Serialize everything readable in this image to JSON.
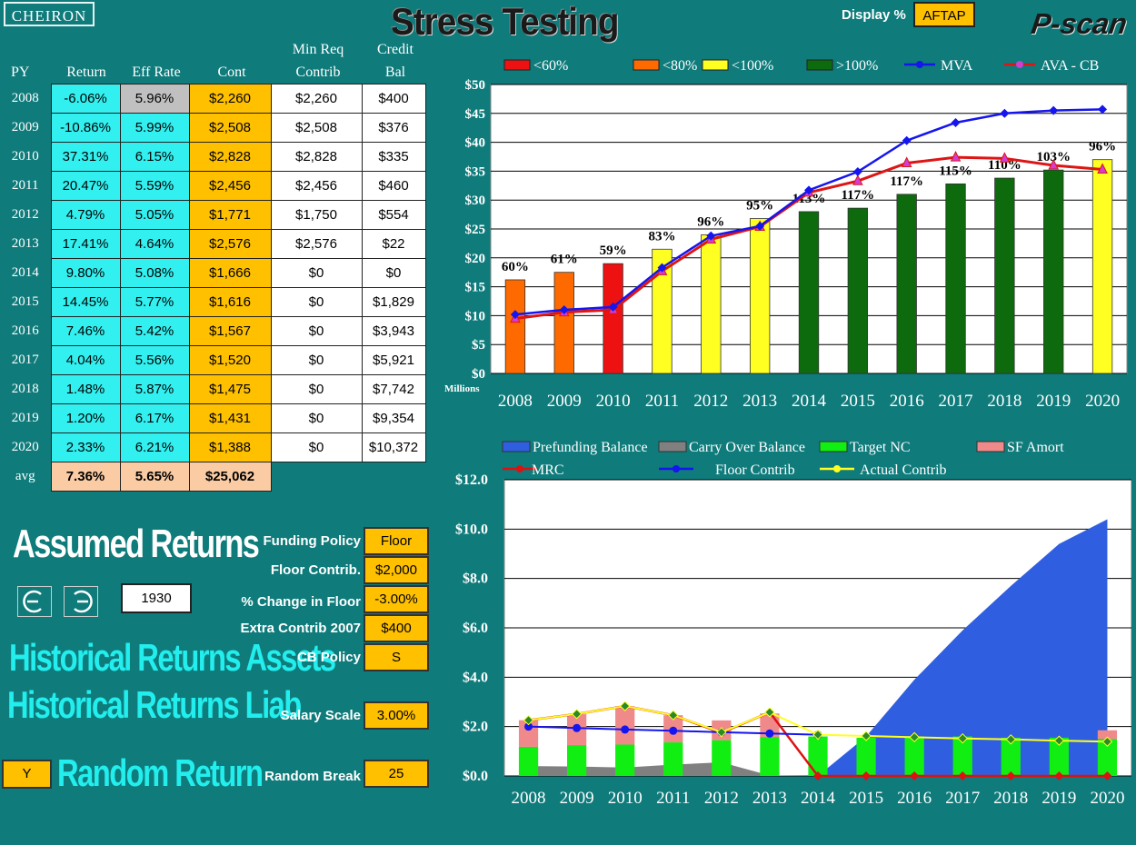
{
  "header": {
    "logo": "CHEIRON",
    "title": "Stress Testing",
    "display_label": "Display %",
    "display_value": "AFTAP",
    "brand": "P-scan"
  },
  "table": {
    "headers": {
      "py": "PY",
      "return": "Return",
      "eff": "Eff Rate",
      "cont": "Cont",
      "minreq1": "Min Req",
      "minreq2": "Contrib",
      "credit1": "Credit",
      "credit2": "Bal"
    },
    "rows": [
      {
        "py": "2008",
        "ret": "-6.06%",
        "eff": "5.96%",
        "cont": "$2,260",
        "min": "$2,260",
        "cred": "$400"
      },
      {
        "py": "2009",
        "ret": "-10.86%",
        "eff": "5.99%",
        "cont": "$2,508",
        "min": "$2,508",
        "cred": "$376"
      },
      {
        "py": "2010",
        "ret": "37.31%",
        "eff": "6.15%",
        "cont": "$2,828",
        "min": "$2,828",
        "cred": "$335"
      },
      {
        "py": "2011",
        "ret": "20.47%",
        "eff": "5.59%",
        "cont": "$2,456",
        "min": "$2,456",
        "cred": "$460"
      },
      {
        "py": "2012",
        "ret": "4.79%",
        "eff": "5.05%",
        "cont": "$1,771",
        "min": "$1,750",
        "cred": "$554"
      },
      {
        "py": "2013",
        "ret": "17.41%",
        "eff": "4.64%",
        "cont": "$2,576",
        "min": "$2,576",
        "cred": "$22"
      },
      {
        "py": "2014",
        "ret": "9.80%",
        "eff": "5.08%",
        "cont": "$1,666",
        "min": "$0",
        "cred": "$0"
      },
      {
        "py": "2015",
        "ret": "14.45%",
        "eff": "5.77%",
        "cont": "$1,616",
        "min": "$0",
        "cred": "$1,829"
      },
      {
        "py": "2016",
        "ret": "7.46%",
        "eff": "5.42%",
        "cont": "$1,567",
        "min": "$0",
        "cred": "$3,943"
      },
      {
        "py": "2017",
        "ret": "4.04%",
        "eff": "5.56%",
        "cont": "$1,520",
        "min": "$0",
        "cred": "$5,921"
      },
      {
        "py": "2018",
        "ret": "1.48%",
        "eff": "5.87%",
        "cont": "$1,475",
        "min": "$0",
        "cred": "$7,742"
      },
      {
        "py": "2019",
        "ret": "1.20%",
        "eff": "6.17%",
        "cont": "$1,431",
        "min": "$0",
        "cred": "$9,354"
      },
      {
        "py": "2020",
        "ret": "2.33%",
        "eff": "6.21%",
        "cont": "$1,388",
        "min": "$0",
        "cred": "$10,372"
      }
    ],
    "avg": {
      "label": "avg",
      "ret": "7.36%",
      "eff": "5.65%",
      "cont": "$25,062"
    }
  },
  "controls": {
    "assumed_returns": "Assumed Returns",
    "hist_assets": "Historical Returns Assets",
    "hist_liab": "Historical Returns Liab",
    "random_return": "Random Return",
    "random_flag": "Y",
    "start_year": "1930",
    "funding_policy_label": "Funding Policy",
    "funding_policy": "Floor",
    "floor_contrib_label": "Floor Contrib.",
    "floor_contrib": "$2,000",
    "pct_change_label": "% Change in Floor",
    "pct_change": "-3.00%",
    "extra_label": "Extra Contrib 2007",
    "extra": "$400",
    "cb_label": "CB Policy",
    "cb": "S",
    "salary_label": "Salary Scale",
    "salary": "3.00%",
    "random_break_label": "Random Break",
    "random_break": "25"
  },
  "chart_data": [
    {
      "type": "bar",
      "categories": [
        "2008",
        "2009",
        "2010",
        "2011",
        "2012",
        "2013",
        "2014",
        "2015",
        "2016",
        "2017",
        "2018",
        "2019",
        "2020"
      ],
      "bar_values": [
        16.2,
        17.5,
        19.0,
        21.5,
        24.0,
        26.8,
        28.0,
        28.6,
        31.0,
        32.8,
        33.8,
        35.2,
        37.0
      ],
      "bar_bands": [
        "<80%",
        "<80%",
        "<60%",
        "<100%",
        "<100%",
        "<100%",
        ">100%",
        ">100%",
        ">100%",
        ">100%",
        ">100%",
        ">100%",
        "<100%"
      ],
      "pct_labels": [
        "60%",
        "61%",
        "59%",
        "83%",
        "96%",
        "95%",
        "113%",
        "117%",
        "117%",
        "115%",
        "110%",
        "103%",
        "96%"
      ],
      "series": [
        {
          "name": "MVA",
          "values": [
            10.2,
            11.0,
            11.5,
            18.3,
            23.8,
            25.5,
            31.7,
            34.9,
            40.3,
            43.4,
            45.0,
            45.5,
            45.7
          ]
        },
        {
          "name": "AVA - CB",
          "values": [
            9.5,
            10.6,
            11.0,
            17.7,
            23.2,
            25.4,
            31.3,
            33.3,
            36.4,
            37.4,
            37.2,
            36.0,
            35.3
          ]
        }
      ],
      "legend": [
        "<60%",
        "<80%",
        "<100%",
        ">100%",
        "MVA",
        "AVA - CB"
      ],
      "colors": {
        "lt60": "#ee1111",
        "lt80": "#ff6a00",
        "lt100": "#ffff22",
        "gt100": "#0d6b0d",
        "mva": "#1515ee",
        "avacb": "#dd1515"
      },
      "yticks": [
        "$0",
        "$5",
        "$10",
        "$15",
        "$20",
        "$25",
        "$30",
        "$35",
        "$40",
        "$45",
        "$50"
      ],
      "ylabel_note": "Millions",
      "ylim": [
        0,
        50
      ]
    },
    {
      "type": "area",
      "categories": [
        "2008",
        "2009",
        "2010",
        "2011",
        "2012",
        "2013",
        "2014",
        "2015",
        "2016",
        "2017",
        "2018",
        "2019",
        "2020"
      ],
      "prefunding": [
        0,
        0,
        0,
        0,
        0,
        0,
        0,
        1.6,
        3.9,
        5.9,
        7.7,
        9.4,
        10.4
      ],
      "carry_over": [
        0.4,
        0.38,
        0.34,
        0.46,
        0.55,
        0.02,
        0,
        0,
        0,
        0,
        0,
        0,
        0
      ],
      "target_nc": [
        1.18,
        1.25,
        1.27,
        1.36,
        1.45,
        1.58,
        1.6,
        1.55,
        1.6,
        1.6,
        1.55,
        1.55,
        1.5
      ],
      "sf_amort": [
        1.08,
        1.25,
        1.55,
        1.1,
        0.8,
        0.95,
        0,
        0,
        0,
        0,
        0,
        0,
        0.35
      ],
      "mrc": [
        2.26,
        2.51,
        2.83,
        2.46,
        1.75,
        2.58,
        0,
        0,
        0,
        0,
        0,
        0,
        0
      ],
      "floor_contrib": [
        2.0,
        1.94,
        1.88,
        1.83,
        1.77,
        1.72,
        1.67,
        null,
        null,
        null,
        null,
        null,
        null
      ],
      "actual_contrib": [
        2.26,
        2.51,
        2.83,
        2.46,
        1.77,
        2.58,
        1.67,
        1.62,
        1.57,
        1.52,
        1.48,
        1.43,
        1.39
      ],
      "legend": [
        "Prefunding Balance",
        "Carry Over Balance",
        "Target NC",
        "SF Amort",
        "MRC",
        "Floor Contrib",
        "Actual Contrib"
      ],
      "colors": {
        "prefunding": "#2f5fe0",
        "carry": "#808080",
        "target": "#11ee11",
        "sf": "#f08a8a",
        "mrc": "#dd1111",
        "floor": "#1515ee",
        "actual": "#ffff22"
      },
      "yticks": [
        "$0.0",
        "$2.0",
        "$4.0",
        "$6.0",
        "$8.0",
        "$10.0",
        "$12.0"
      ],
      "ylim": [
        0,
        12
      ]
    }
  ]
}
